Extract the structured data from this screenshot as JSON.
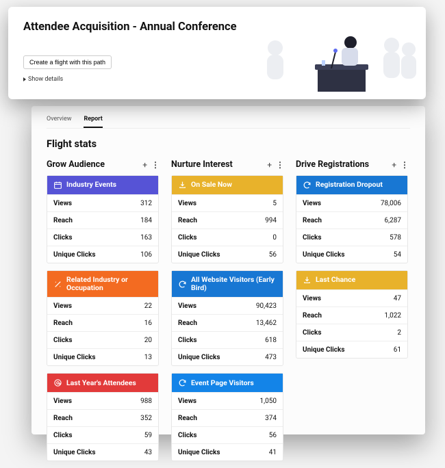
{
  "header": {
    "title": "Attendee Acquisition - Annual Conference",
    "create_btn": "Create a flight with this path",
    "show_details": "Show details"
  },
  "tabs": {
    "overview": "Overview",
    "report": "Report"
  },
  "section_title": "Flight stats",
  "metric_labels": {
    "views": "Views",
    "reach": "Reach",
    "clicks": "Clicks",
    "unique": "Unique Clicks"
  },
  "glyphs": {
    "plus": "+",
    "more": "⋮"
  },
  "columns": [
    {
      "title": "Grow Audience",
      "blocks": [
        {
          "name": "Industry Events",
          "color": "bh-purple",
          "icon": "calendar-icon",
          "views": "312",
          "reach": "184",
          "clicks": "163",
          "unique": "106"
        },
        {
          "name": "Related Industry or Occupation",
          "color": "bh-orange",
          "icon": "wand-icon",
          "views": "22",
          "reach": "16",
          "clicks": "20",
          "unique": "13"
        },
        {
          "name": "Last Year's Attendees",
          "color": "bh-red",
          "icon": "at-icon",
          "views": "988",
          "reach": "352",
          "clicks": "59",
          "unique": "43"
        }
      ]
    },
    {
      "title": "Nurture Interest",
      "blocks": [
        {
          "name": "On Sale Now",
          "color": "bh-gold",
          "icon": "download-icon",
          "views": "5",
          "reach": "994",
          "clicks": "0",
          "unique": "56"
        },
        {
          "name": "All Website Visitors (Early Bird)",
          "color": "bh-blue",
          "icon": "refresh-icon",
          "views": "90,423",
          "reach": "13,462",
          "clicks": "618",
          "unique": "473"
        },
        {
          "name": "Event Page Visitors",
          "color": "bh-blue2",
          "icon": "refresh-icon",
          "views": "1,050",
          "reach": "374",
          "clicks": "56",
          "unique": "41"
        }
      ]
    },
    {
      "title": "Drive Registrations",
      "blocks": [
        {
          "name": "Registration Dropout",
          "color": "bh-blue",
          "icon": "refresh-icon",
          "views": "78,006",
          "reach": "6,287",
          "clicks": "578",
          "unique": "54"
        },
        {
          "name": "Last Chance",
          "color": "bh-gold2",
          "icon": "download-icon",
          "views": "47",
          "reach": "1,022",
          "clicks": "2",
          "unique": "61"
        }
      ]
    }
  ]
}
